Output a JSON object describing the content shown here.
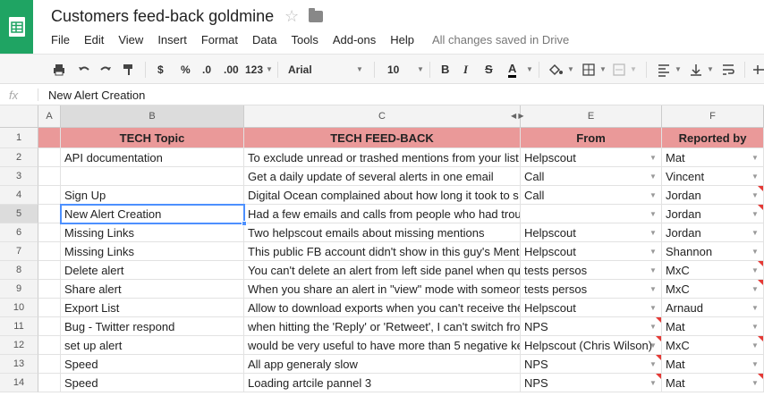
{
  "doc": {
    "title": "Customers feed-back goldmine",
    "saved_status": "All changes saved in Drive"
  },
  "menu": [
    "File",
    "Edit",
    "View",
    "Insert",
    "Format",
    "Data",
    "Tools",
    "Add-ons",
    "Help"
  ],
  "toolbar": {
    "currency": "$",
    "percent": "%",
    "dec_decrease": ".0",
    "dec_increase": ".00",
    "more_formats": "123",
    "font": "Arial",
    "font_size": "10",
    "bold": "B",
    "italic": "I",
    "strike": "S",
    "text_color": "A"
  },
  "formula_bar": {
    "fx": "fx",
    "value": "New Alert Creation"
  },
  "grid": {
    "columns": [
      "A",
      "B",
      "C",
      "E",
      "F"
    ],
    "header_row": {
      "num": "1",
      "b": "TECH Topic",
      "c": "TECH FEED-BACK",
      "e": "From",
      "f": "Reported by"
    },
    "rows": [
      {
        "num": "2",
        "b": "API documentation",
        "c": "To exclude unread or trashed mentions from your list",
        "e": "Helpscout",
        "f": "Mat",
        "flag_f": false,
        "flag_e": false
      },
      {
        "num": "3",
        "b": "",
        "c": "Get a daily update of several alerts in one email",
        "e": "Call",
        "f": "Vincent",
        "flag_f": false,
        "flag_e": false
      },
      {
        "num": "4",
        "b": "Sign Up",
        "c": "Digital Ocean complained about how long it took to s",
        "e": "Call",
        "f": "Jordan",
        "flag_f": true,
        "flag_e": false
      },
      {
        "num": "5",
        "b": "New Alert Creation",
        "c": "Had a few emails and calls from people who had trou",
        "e": "",
        "f": "Jordan",
        "flag_f": true,
        "flag_e": false
      },
      {
        "num": "6",
        "b": "Missing Links",
        "c": "Two helpscout emails about missing mentions",
        "e": "Helpscout",
        "f": "Jordan",
        "flag_f": false,
        "flag_e": false
      },
      {
        "num": "7",
        "b": "Missing Links",
        "c": "This public FB account didn't show in this guy's Ment",
        "e": "Helpscout",
        "f": "Shannon",
        "flag_f": false,
        "flag_e": false
      },
      {
        "num": "8",
        "b": "Delete alert",
        "c": "You can't delete an alert from left side panel when qu",
        "e": "tests persos",
        "f": "MxC",
        "flag_f": true,
        "flag_e": false
      },
      {
        "num": "9",
        "b": "Share alert",
        "c": "When you share an alert in \"view\" mode with someor",
        "e": "tests persos",
        "f": "MxC",
        "flag_f": true,
        "flag_e": false
      },
      {
        "num": "10",
        "b": "Export List",
        "c": "Allow to download exports when you can't receive the",
        "e": "Helpscout",
        "f": "Arnaud",
        "flag_f": false,
        "flag_e": false
      },
      {
        "num": "11",
        "b": "Bug - Twitter respond",
        "c": "when hitting the 'Reply' or 'Retweet', I can't switch fro",
        "e": "NPS",
        "f": "Mat",
        "flag_f": false,
        "flag_e": true
      },
      {
        "num": "12",
        "b": "set up alert",
        "c": "would be very useful to have more than 5 negative ke",
        "e": "Helpscout (Chris Wilson)",
        "f": "MxC",
        "flag_f": true,
        "flag_e": true
      },
      {
        "num": "13",
        "b": "Speed",
        "c": "All app generaly slow",
        "e": "NPS",
        "f": "Mat",
        "flag_f": false,
        "flag_e": true
      },
      {
        "num": "14",
        "b": "Speed",
        "c": "Loading artcile pannel 3",
        "e": "NPS",
        "f": "Mat",
        "flag_f": true,
        "flag_e": true
      }
    ]
  },
  "colors": {
    "logo_green": "#1fa463",
    "header_fill": "#ea9999",
    "selection": "#4d90fe",
    "comment_flag": "#e53935"
  }
}
